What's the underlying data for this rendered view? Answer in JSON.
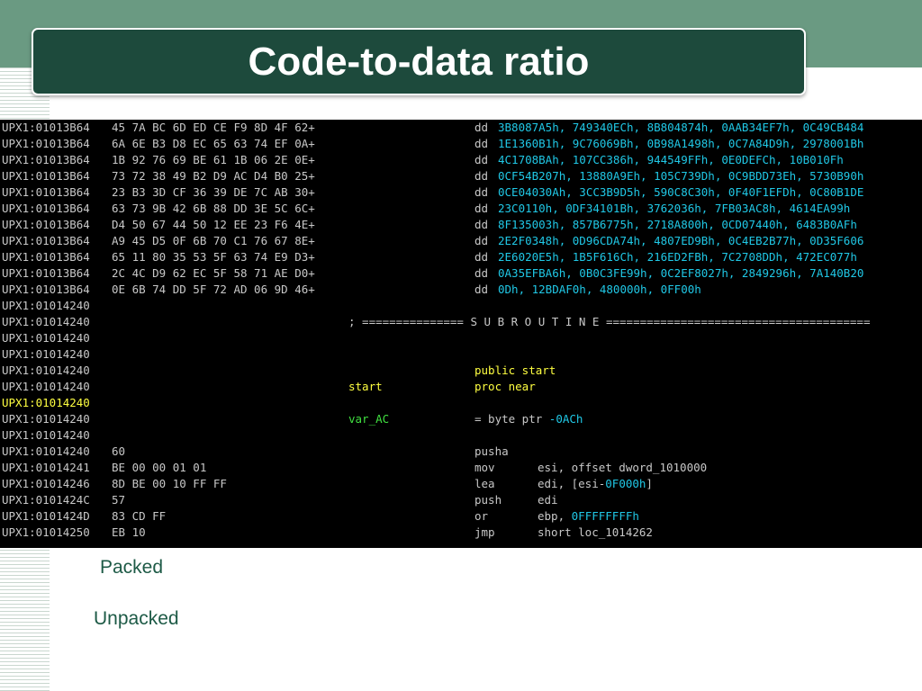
{
  "slide": {
    "title": "Code-to-data ratio",
    "captions": {
      "packed": "Packed",
      "unpacked": "Unpacked"
    }
  },
  "disassembly": {
    "data_rows": [
      {
        "addr": "UPX1:01013B64",
        "bytes": "45 7A BC 6D ED CE F9 8D 4F 62+",
        "kw": "dd",
        "values": "3B8087A5h, 749340ECh, 8B804874h, 0AAB34EF7h, 0C49CB484"
      },
      {
        "addr": "UPX1:01013B64",
        "bytes": "6A 6E B3 D8 EC 65 63 74 EF 0A+",
        "kw": "dd",
        "values": "1E1360B1h, 9C76069Bh, 0B98A1498h, 0C7A84D9h, 2978001Bh"
      },
      {
        "addr": "UPX1:01013B64",
        "bytes": "1B 92 76 69 BE 61 1B 06 2E 0E+",
        "kw": "dd",
        "values": "4C1708BAh, 107CC386h, 944549FFh, 0E0DEFCh, 10B010Fh"
      },
      {
        "addr": "UPX1:01013B64",
        "bytes": "73 72 38 49 B2 D9 AC D4 B0 25+",
        "kw": "dd",
        "values": "0CF54B207h, 13880A9Eh, 105C739Dh, 0C9BDD73Eh, 5730B90h"
      },
      {
        "addr": "UPX1:01013B64",
        "bytes": "23 B3 3D CF 36 39 DE 7C AB 30+",
        "kw": "dd",
        "values": "0CE04030Ah, 3CC3B9D5h, 590C8C30h, 0F40F1EFDh, 0C80B1DE"
      },
      {
        "addr": "UPX1:01013B64",
        "bytes": "63 73 9B 42 6B 88 DD 3E 5C 6C+",
        "kw": "dd",
        "values": "23C0110h, 0DF34101Bh, 3762036h, 7FB03AC8h, 4614EA99h"
      },
      {
        "addr": "UPX1:01013B64",
        "bytes": "D4 50 67 44 50 12 EE 23 F6 4E+",
        "kw": "dd",
        "values": "8F135003h, 857B6775h, 2718A800h, 0CD07440h, 6483B0AFh"
      },
      {
        "addr": "UPX1:01013B64",
        "bytes": "A9 45 D5 0F 6B 70 C1 76 67 8E+",
        "kw": "dd",
        "values": "2E2F0348h, 0D96CDA74h, 4807ED9Bh, 0C4EB2B77h, 0D35F606"
      },
      {
        "addr": "UPX1:01013B64",
        "bytes": "65 11 80 35 53 5F 63 74 E9 D3+",
        "kw": "dd",
        "values": "2E6020E5h, 1B5F616Ch, 216ED2FBh, 7C2708DDh, 472EC077h"
      },
      {
        "addr": "UPX1:01013B64",
        "bytes": "2C 4C D9 62 EC 5F 58 71 AE D0+",
        "kw": "dd",
        "values": "0A35EFBA6h, 0B0C3FE99h, 0C2EF8027h, 2849296h, 7A140B20"
      },
      {
        "addr": "UPX1:01013B64",
        "bytes": "0E 6B 74 DD 5F 72 AD 06 9D 46+",
        "kw": "dd",
        "values": "0Dh, 12BDAF0h, 480000h, 0FF00h"
      }
    ],
    "blank_addr": "UPX1:01014240",
    "separator": "; =============== S U B R O U T I N E =======================================",
    "public_start": "public start",
    "start_label": "start",
    "proc_near": "proc near",
    "highlighted_addr": "UPX1:01014240",
    "var_label": "var_AC",
    "var_def_prefix": "= byte ptr ",
    "var_def_value": "-0ACh",
    "code_rows": [
      {
        "addr": "UPX1:01014240",
        "bytes": "60",
        "op": "pusha",
        "args": ""
      },
      {
        "addr": "UPX1:01014241",
        "bytes": "BE 00 00 01 01",
        "op": "mov",
        "args": "esi, offset dword_1010000"
      },
      {
        "addr": "UPX1:01014246",
        "bytes": "8D BE 00 10 FF FF",
        "op": "lea",
        "args": "edi, [esi-",
        "args_cyan": "0F000h",
        "args_tail": "]"
      },
      {
        "addr": "UPX1:0101424C",
        "bytes": "57",
        "op": "push",
        "args": "edi"
      },
      {
        "addr": "UPX1:0101424D",
        "bytes": "83 CD FF",
        "op": "or",
        "args": "ebp, ",
        "args_cyan": "0FFFFFFFFh"
      },
      {
        "addr": "UPX1:01014250",
        "bytes": "EB 10",
        "op": "jmp",
        "args": "short loc_1014262"
      }
    ]
  },
  "colors": {
    "top_band": "#6a9a82",
    "title_box": "#1d4a3c",
    "caption": "#1d5a46",
    "ida_background": "#000000",
    "ida_text": "#c8c8c8",
    "ida_yellow": "#ffff40",
    "ida_cyan": "#20c8e6"
  }
}
